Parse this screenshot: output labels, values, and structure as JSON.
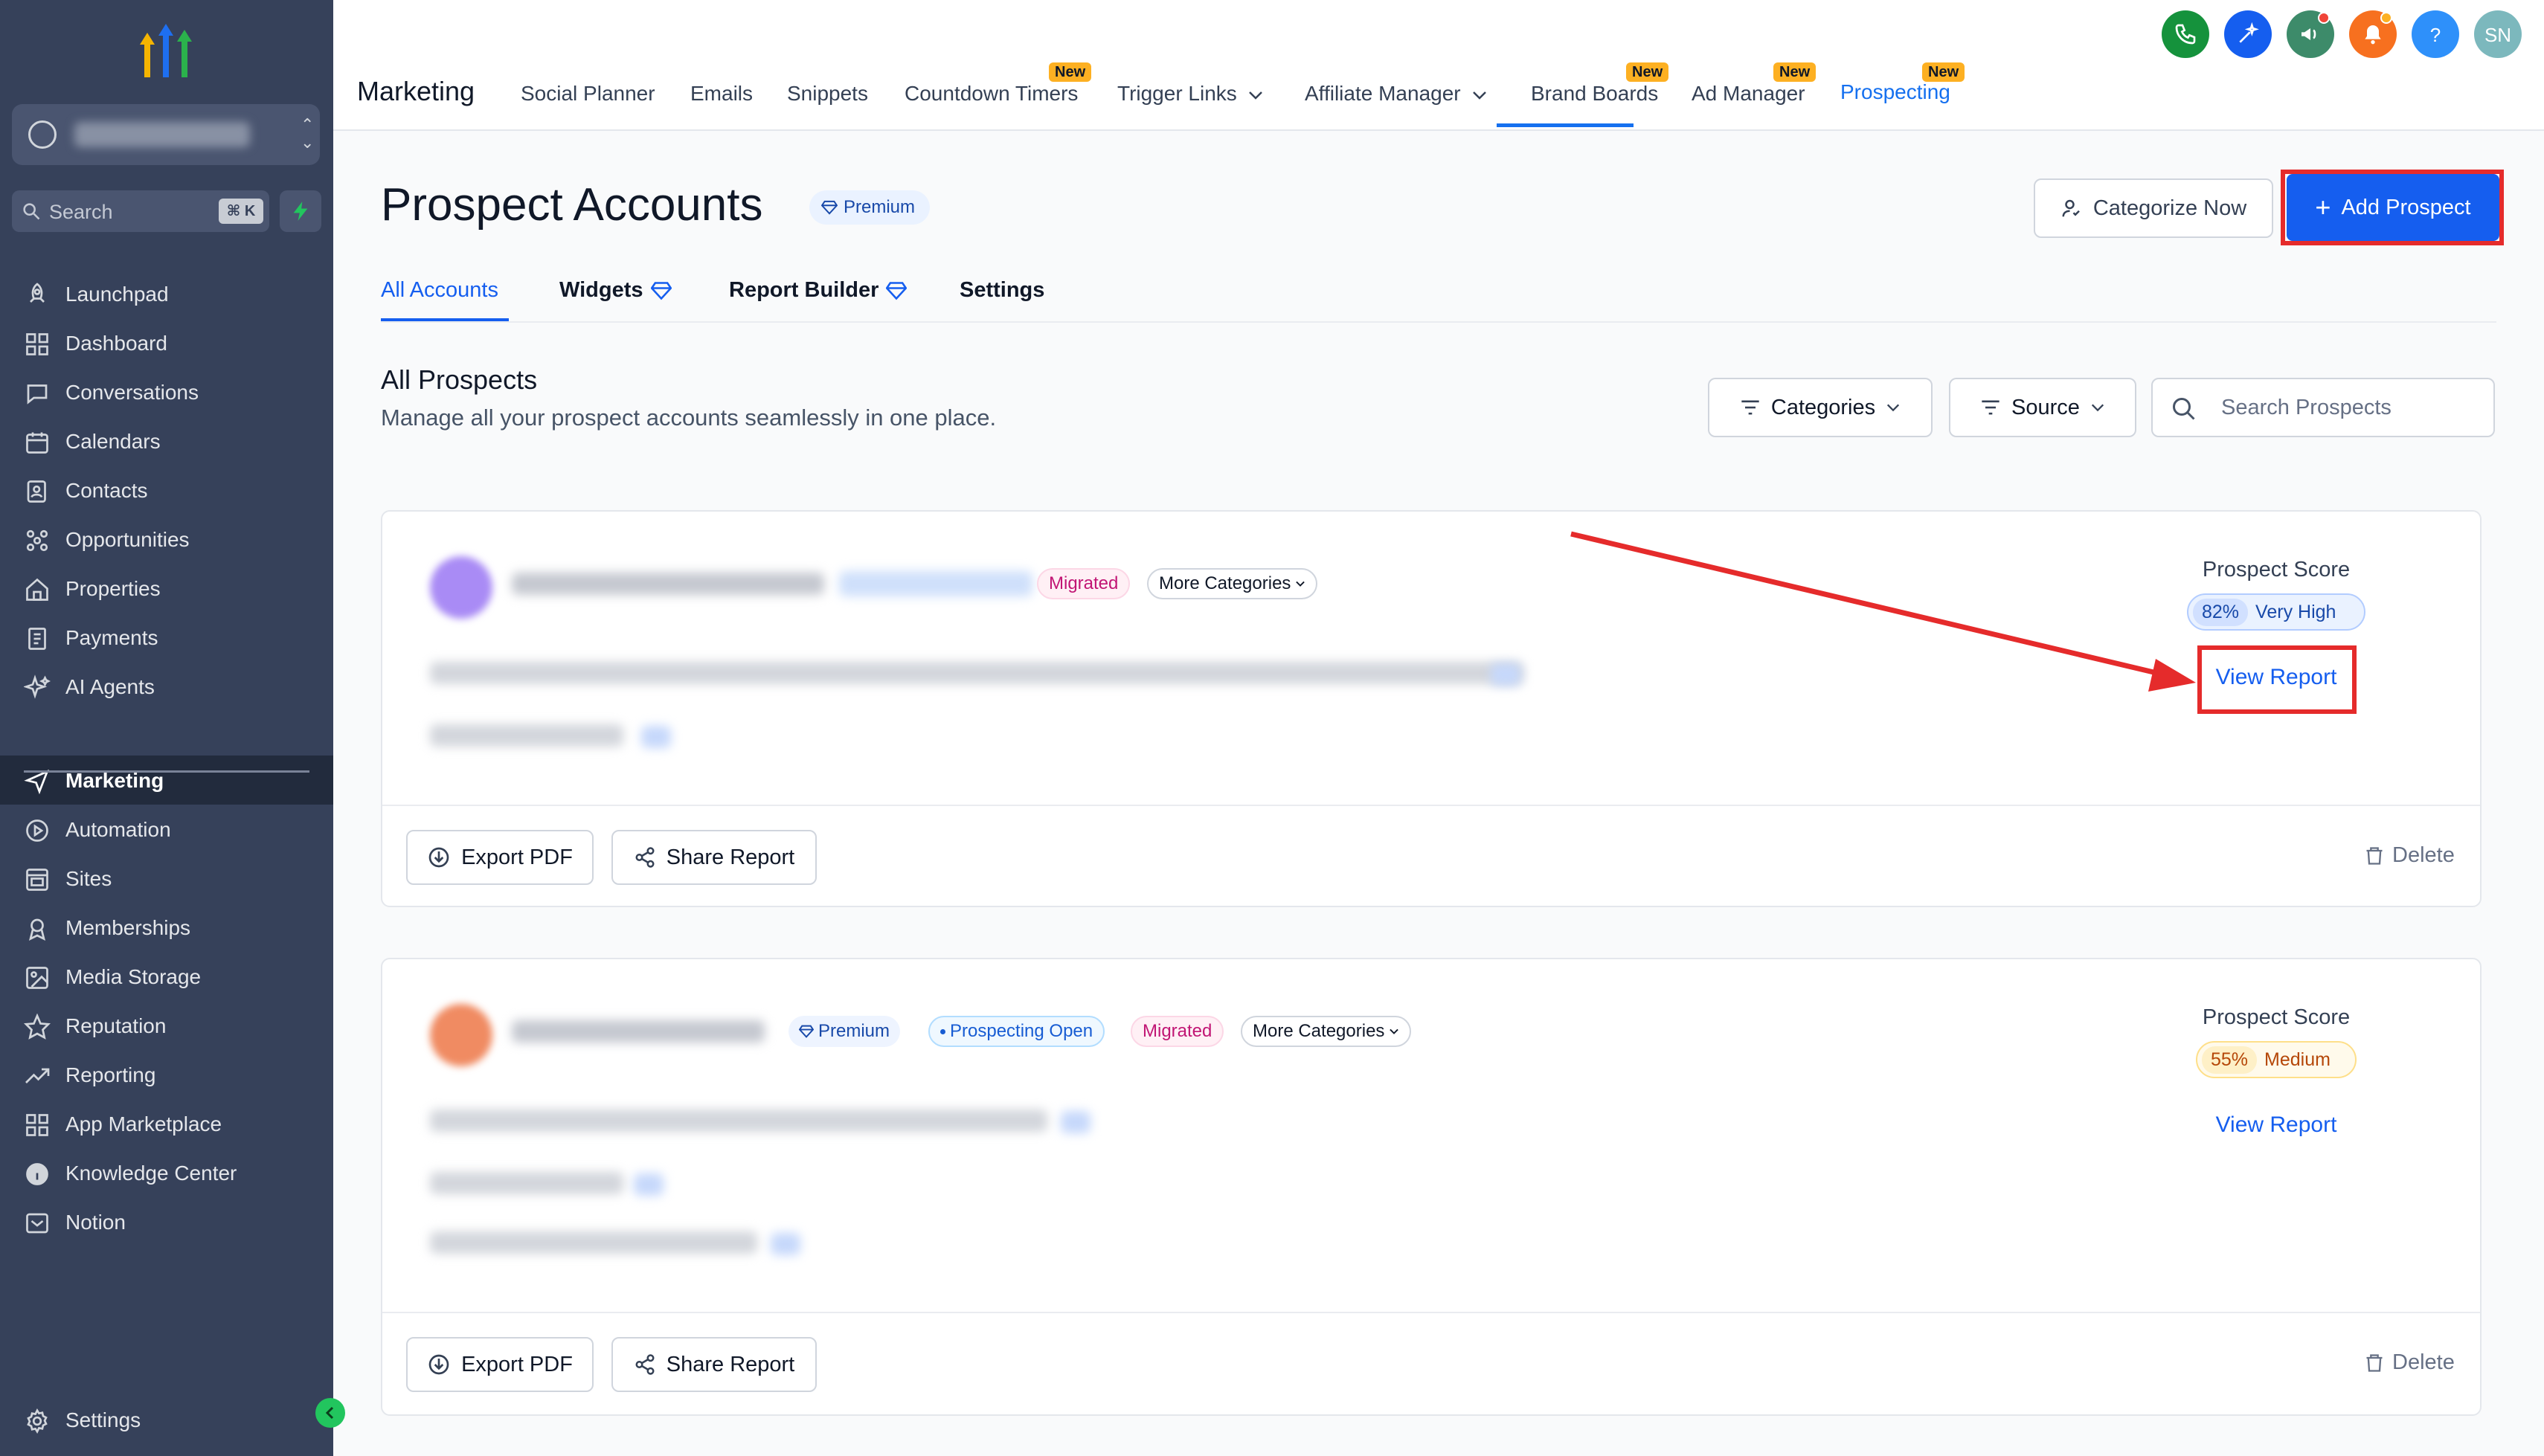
{
  "sidebar": {
    "search_placeholder": "Search",
    "search_shortcut": "⌘ K",
    "items": [
      {
        "label": "Launchpad",
        "icon": "rocket-icon"
      },
      {
        "label": "Dashboard",
        "icon": "grid-icon"
      },
      {
        "label": "Conversations",
        "icon": "chat-icon"
      },
      {
        "label": "Calendars",
        "icon": "calendar-icon"
      },
      {
        "label": "Contacts",
        "icon": "contacts-icon"
      },
      {
        "label": "Opportunities",
        "icon": "opportunities-icon"
      },
      {
        "label": "Properties",
        "icon": "home-icon"
      },
      {
        "label": "Payments",
        "icon": "payments-icon"
      },
      {
        "label": "AI Agents",
        "icon": "sparkles-icon"
      },
      {
        "label": "Marketing",
        "icon": "send-icon",
        "active": true
      },
      {
        "label": "Automation",
        "icon": "automation-icon"
      },
      {
        "label": "Sites",
        "icon": "sites-icon"
      },
      {
        "label": "Memberships",
        "icon": "memberships-icon"
      },
      {
        "label": "Media Storage",
        "icon": "image-icon"
      },
      {
        "label": "Reputation",
        "icon": "star-icon"
      },
      {
        "label": "Reporting",
        "icon": "trend-icon"
      },
      {
        "label": "App Marketplace",
        "icon": "apps-icon"
      },
      {
        "label": "Knowledge Center",
        "icon": "info-icon"
      },
      {
        "label": "Notion",
        "icon": "notion-icon"
      }
    ],
    "settings_label": "Settings"
  },
  "topnav": {
    "section": "Marketing",
    "tabs": [
      {
        "label": "Social Planner"
      },
      {
        "label": "Emails"
      },
      {
        "label": "Snippets"
      },
      {
        "label": "Countdown Timers",
        "badge": "New"
      },
      {
        "label": "Trigger Links",
        "dropdown": true
      },
      {
        "label": "Affiliate Manager",
        "dropdown": true
      },
      {
        "label": "Brand Boards",
        "badge": "New"
      },
      {
        "label": "Ad Manager",
        "badge": "New"
      },
      {
        "label": "Prospecting",
        "badge": "New",
        "active": true
      }
    ],
    "avatar_initials": "SN",
    "help_label": "?"
  },
  "header": {
    "title": "Prospect Accounts",
    "premium_label": "Premium",
    "categorize_label": "Categorize Now",
    "add_label": "Add Prospect"
  },
  "subtabs": [
    {
      "label": "All Accounts",
      "active": true
    },
    {
      "label": "Widgets",
      "premium": true
    },
    {
      "label": "Report Builder",
      "premium": true
    },
    {
      "label": "Settings"
    }
  ],
  "listing": {
    "title": "All Prospects",
    "subtitle": "Manage all your prospect accounts seamlessly in one place.",
    "categories_label": "Categories",
    "source_label": "Source",
    "search_placeholder": "Search Prospects"
  },
  "cards": [
    {
      "chips": {
        "migrated": "Migrated",
        "more": "More Categories"
      },
      "score_label": "Prospect Score",
      "score_pct": "82%",
      "score_level": "Very High",
      "view_report": "View Report",
      "export_label": "Export PDF",
      "share_label": "Share Report",
      "delete_label": "Delete"
    },
    {
      "chips": {
        "premium": "Premium",
        "prospecting": "Prospecting Open",
        "migrated": "Migrated",
        "more": "More Categories"
      },
      "score_label": "Prospect Score",
      "score_pct": "55%",
      "score_level": "Medium",
      "view_report": "View Report",
      "export_label": "Export PDF",
      "share_label": "Share Report",
      "delete_label": "Delete"
    }
  ],
  "colors": {
    "sidebar_bg": "#36415a",
    "primary": "#155eef",
    "annotation_red": "#e52b2b",
    "new_badge": "#fdb022"
  }
}
